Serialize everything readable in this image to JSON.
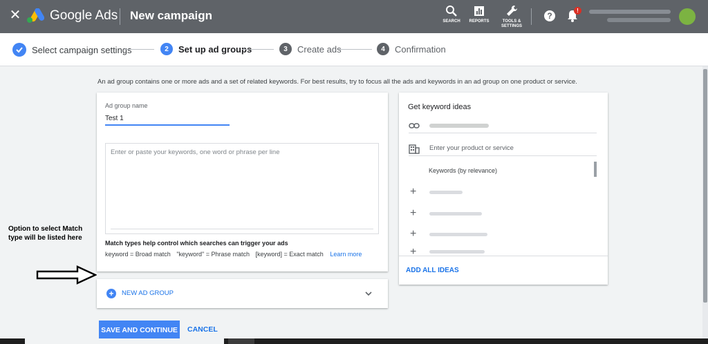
{
  "topbar": {
    "brand": "Google Ads",
    "title": "New campaign",
    "tools": [
      {
        "label": "SEARCH",
        "icon": "search-icon"
      },
      {
        "label": "REPORTS",
        "icon": "reports-icon"
      },
      {
        "label": "TOOLS & SETTINGS",
        "icon": "wrench-icon"
      }
    ],
    "help": "?",
    "notification_badge": "!"
  },
  "stepper": {
    "steps": [
      {
        "num": "",
        "label": "Select campaign settings",
        "state": "done"
      },
      {
        "num": "2",
        "label": "Set up ad groups",
        "state": "active"
      },
      {
        "num": "3",
        "label": "Create ads",
        "state": "pending"
      },
      {
        "num": "4",
        "label": "Confirmation",
        "state": "pending"
      }
    ]
  },
  "intro": "An ad group contains one or more ads and a set of related keywords. For best results, try to focus all the ads and keywords in an ad group on one product or service.",
  "ad_group": {
    "name_label": "Ad group name",
    "name_value": "Test 1",
    "keywords_placeholder": "Enter or paste your keywords, one word or phrase per line",
    "match_help": "Match types help control which searches can trigger your ads",
    "match_types": [
      "keyword = Broad match",
      "\"keyword\" = Phrase match",
      "[keyword] = Exact match"
    ],
    "learn_more": "Learn more"
  },
  "new_ad_group": {
    "label": "NEW AD GROUP"
  },
  "keyword_ideas": {
    "title": "Get keyword ideas",
    "product_placeholder": "Enter your product or service",
    "sort_label": "Keywords (by relevance)",
    "add_all": "ADD ALL IDEAS"
  },
  "actions": {
    "save": "SAVE AND CONTINUE",
    "cancel": "CANCEL"
  },
  "annotation": "Option to select Match type will be listed here",
  "colors": {
    "topbar": "#5f6368",
    "accent": "#4285f4",
    "link": "#1a73e8"
  }
}
